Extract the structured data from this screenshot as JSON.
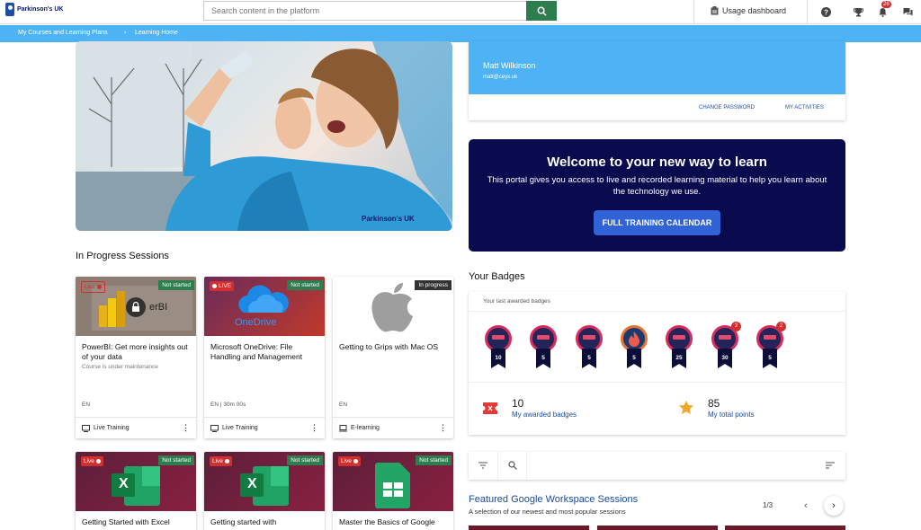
{
  "brand": {
    "logo_text": "Parkinson's UK"
  },
  "search": {
    "placeholder": "Search content in the platform"
  },
  "topbar": {
    "usage_label": "Usage dashboard",
    "notifications_count": "26"
  },
  "breadcrumb": [
    "My Courses and Learning Plans",
    "Learning Home"
  ],
  "hero": {
    "watermark": "Parkinson's UK"
  },
  "profile": {
    "name": "Matt Wilkinson",
    "email": "matt@ceyx.uk",
    "change_password": "CHANGE PASSWORD",
    "my_activities": "MY ACTIVITIES"
  },
  "welcome": {
    "title": "Welcome to your new way to learn",
    "text": "This portal gives you access to live and recorded learning material to help you learn about the technology we use.",
    "button": "FULL TRAINING CALENDAR"
  },
  "in_progress": {
    "title": "In Progress Sessions",
    "cards": [
      {
        "title": "PowerBI: Get more insights out of your data",
        "subtitle": "Course is under maintenance",
        "status": "Not started",
        "live": "Live",
        "lang": "EN",
        "type": "Live Training",
        "thumb_text": "erBI"
      },
      {
        "title": "Microsoft OneDrive: File Handling and Management",
        "subtitle": "",
        "status": "Not started",
        "live": "LIVE",
        "lang": "EN | 30m 00s",
        "type": "Live Training",
        "thumb_text": "OneDrive"
      },
      {
        "title": "Getting to Grips with Mac OS",
        "subtitle": "",
        "status": "In progress",
        "live": "",
        "lang": "EN",
        "type": "E-learning",
        "thumb_text": ""
      },
      {
        "title": "Getting Started with Excel",
        "status": "Not started",
        "live": "Live",
        "thumb_text": "X"
      },
      {
        "title": "Getting started with",
        "status": "Not started",
        "live": "Live",
        "thumb_text": "X"
      },
      {
        "title": "Master the Basics of Google",
        "status": "Not started",
        "live": "Live",
        "thumb_text": ""
      }
    ]
  },
  "badges": {
    "title": "Your Badges",
    "subtitle": "Your last awarded badges",
    "items": [
      {
        "points": "10",
        "count": ""
      },
      {
        "points": "5",
        "count": ""
      },
      {
        "points": "5",
        "count": ""
      },
      {
        "points": "5",
        "count": ""
      },
      {
        "points": "25",
        "count": ""
      },
      {
        "points": "30",
        "count": "3"
      },
      {
        "points": "5",
        "count": "2"
      }
    ],
    "awarded_count": "10",
    "awarded_label": "My awarded badges",
    "total_points": "85",
    "points_label": "My total points"
  },
  "featured": {
    "title": "Featured Google Workspace Sessions",
    "subtitle": "A selection of our newest and most popular sessions",
    "page": "1/3"
  },
  "colors": {
    "accent": "#4db3f5",
    "navy": "#0a0a4f",
    "button": "#2f63d6",
    "search_green": "#2e7d4f",
    "status_green": "#2e7d4f"
  }
}
